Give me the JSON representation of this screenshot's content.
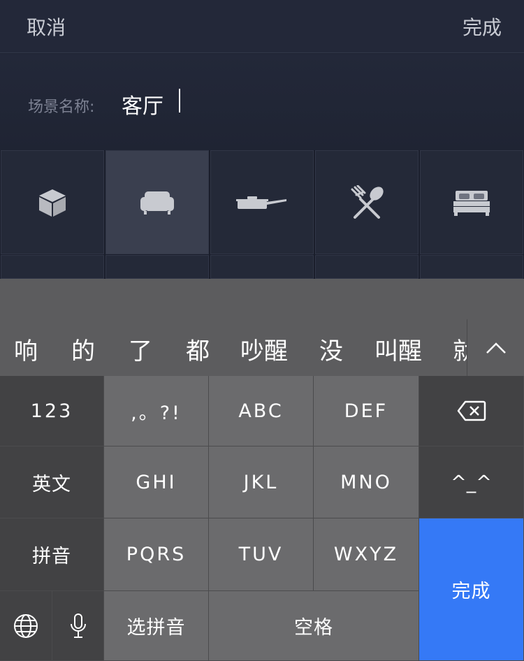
{
  "nav": {
    "cancel": "取消",
    "done": "完成"
  },
  "scene": {
    "label": "场景名称:",
    "value": "客厅"
  },
  "icons": [
    {
      "name": "box-icon",
      "selected": false
    },
    {
      "name": "sofa-icon",
      "selected": true
    },
    {
      "name": "pan-icon",
      "selected": false
    },
    {
      "name": "fork-spoon-icon",
      "selected": false
    },
    {
      "name": "bed-icon",
      "selected": false
    }
  ],
  "candidates": [
    "响",
    "的",
    "了",
    "都",
    "吵醒",
    "没",
    "叫醒",
    "就"
  ],
  "keyboard": {
    "row1": [
      "123",
      ",。?!",
      "ABC",
      "DEF"
    ],
    "row2": [
      "英文",
      "GHI",
      "JKL",
      "MNO",
      "^_^"
    ],
    "row3": [
      "拼音",
      "PQRS",
      "TUV",
      "WXYZ"
    ],
    "row4": [
      "选拼音",
      "空格"
    ],
    "done": "完成"
  },
  "colors": {
    "accent": "#3579f6",
    "background": "#1f2433",
    "keyboard": "#6b6b6d"
  }
}
